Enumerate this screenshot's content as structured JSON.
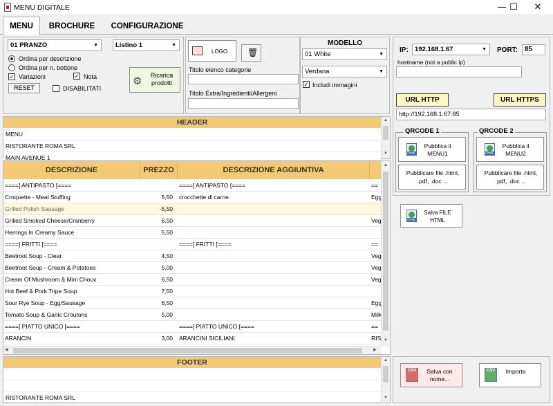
{
  "window": {
    "title": "MENU DIGITALE",
    "minimize": "—",
    "maximize": "☐",
    "close": "✕"
  },
  "tabs": [
    {
      "label": "MENU"
    },
    {
      "label": "BROCHURE"
    },
    {
      "label": "CONFIGURAZIONE"
    }
  ],
  "left_panel": {
    "menu_select": "01 PRANZO",
    "listino_select": "Listino 1",
    "order_by_description": "Ordina per descrizione",
    "order_by_button": "Ordina per n. bottone",
    "variazioni": "Variazioni",
    "nota": "Nota",
    "reset": "RESET",
    "disabilitati": "DISABILITATI",
    "ricarica": "Ricarica prodotti"
  },
  "mid_panel": {
    "logo": "LOGO",
    "titolo_categorie_label": "Titolo elenco categorie",
    "titolo_extra_label": "Titolo Extra/Ingredienti/Allergeni"
  },
  "modello_panel": {
    "heading": "MODELLO",
    "model_select": "01 White",
    "font_select": "Verdana",
    "includi_immagini": "Includi immagini"
  },
  "header_section": {
    "title": "HEADER",
    "lines": [
      "MENU",
      "RISTORANTE ROMA SRL",
      "MAIN AVENUE 1"
    ]
  },
  "grid": {
    "columns": [
      "DESCRIZIONE",
      "PREZZO",
      "DESCRIZIONE AGGIUNTIVA"
    ],
    "rows": [
      [
        "====]  ANTIPASTO [====",
        "",
        "====]  ANTIPASTO [====",
        "=="
      ],
      [
        "Croquette - Meat Stuffing",
        "5,50",
        "crocchette di carne",
        "Egg"
      ],
      [
        "Grilled Polish Sausage",
        "-5,50",
        "",
        ""
      ],
      [
        "Grilled Smoked Cheese/Cranberry",
        "6,50",
        "",
        "Veg"
      ],
      [
        "Herrings In Creamy Sauce",
        "5,50",
        "",
        ""
      ],
      [
        "====]  FRITTI [====",
        "",
        "====]  FRITTI [====",
        "=="
      ],
      [
        "Beetroot Soup - Clear",
        "4,50",
        "",
        "Veg"
      ],
      [
        "Beetroot Soup - Cream & Potatoes",
        "5,00",
        "",
        "Veg"
      ],
      [
        "Cream Of Mushroom & Mini Choux",
        "6,50",
        "",
        "Veg"
      ],
      [
        "Hot Beef & Pork Tripe Soup",
        "7,50",
        "",
        ""
      ],
      [
        "Sour Rye Soup - Egg/Sausage",
        "6,50",
        "",
        "Egg"
      ],
      [
        "Tomato Soup & Garlic Croutons",
        "5,00",
        "",
        "Milk"
      ],
      [
        "====]  PIATTO UNICO [====",
        "",
        "====]  PIATTO UNICO [====",
        "=="
      ],
      [
        "ARANCIN",
        "3,00",
        "ARANCINI SICILIANI",
        "RIS"
      ]
    ]
  },
  "footer_section": {
    "title": "FOOTER",
    "lines": [
      "",
      "",
      "RISTORANTE ROMA SRL"
    ]
  },
  "network": {
    "ip_label": "IP:",
    "ip_value": "192.168.1.67",
    "port_label": "PORT:",
    "port_value": "85",
    "hostname_label": "hostname  (not a public ip)",
    "url_http": "URL HTTP",
    "url_https": "URL HTTPS",
    "url_value": "http://192.168.1.67:85"
  },
  "qrcode1": {
    "legend": "QRCODE 1",
    "publish": "Pubblica il MENU1",
    "files": "Pubblicare file .html, .pdf, .doc ..."
  },
  "qrcode2": {
    "legend": "QRCODE 2",
    "publish": "Pubblica il MENU2",
    "files": "Pubblicare file .html, .pdf, .doc ..."
  },
  "save_html": "Salva FILE HTML",
  "csv": {
    "save_as": "Salva con nome...",
    "import": "Importa"
  },
  "colors": {
    "section_header": "#f3c973",
    "url_button": "#fdf7c3",
    "selected_row": "#fdf8dc"
  }
}
